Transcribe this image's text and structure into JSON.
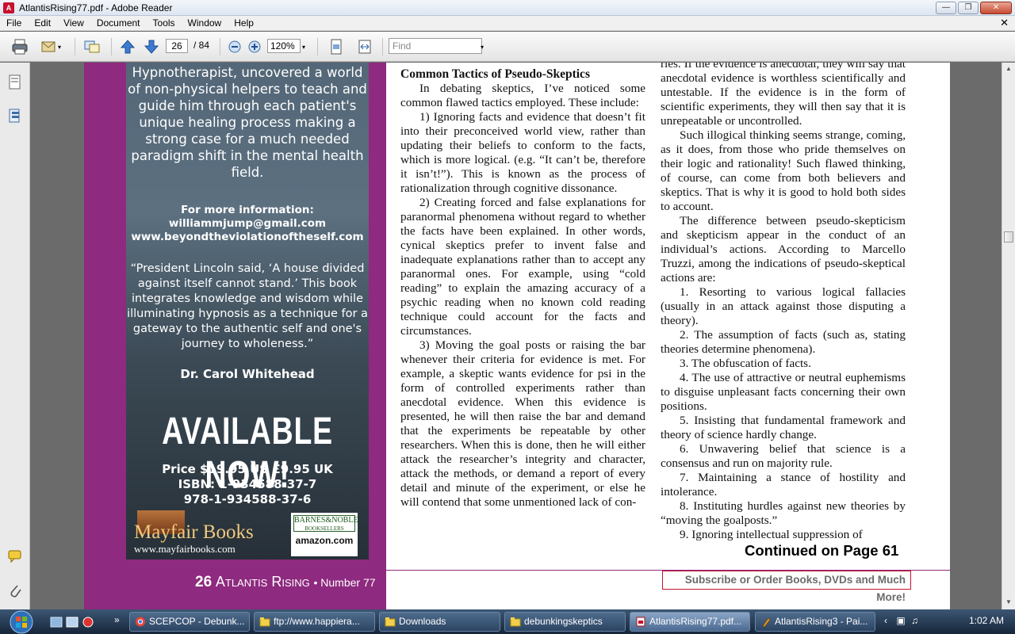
{
  "window": {
    "title": "AtlantisRising77.pdf - Adobe Reader"
  },
  "menu": [
    "File",
    "Edit",
    "View",
    "Document",
    "Tools",
    "Window",
    "Help"
  ],
  "toolbar": {
    "page_current": "26",
    "page_total": "/ 84",
    "zoom": "120%",
    "find_placeholder": "Find"
  },
  "ad": {
    "intro": "Hypnotherapist, uncovered a world of non-physical helpers to teach and guide him through each patient's unique healing process making a strong case for a much needed paradigm shift in the mental health field.",
    "info_heading": "For more information:",
    "email": "williammjump@gmail.com",
    "website": "www.beyondtheviolationoftheself.com",
    "quote": "“President Lincoln said, ‘A house divided against itself cannot stand.’ This book integrates knowledge and wisdom while illuminating hypnosis as a technique for a gateway to the authentic self and one's journey to wholeness.”",
    "quote_author": "Dr. Carol Whitehead",
    "available": "AVAILABLE NOW!",
    "price": "Price $19.95 US £9.95 UK",
    "isbn1": "ISBN: 1-934588-37-7",
    "isbn2": "978-1-934588-37-6",
    "publisher": "Mayfair Books",
    "publisher_url": "www.mayfairbooks.com",
    "bn_line1": "BARNES&NOBLE",
    "bn_line2": "BOOKSELLERS",
    "amazon": "amazon.com"
  },
  "footer": {
    "page_num": "26",
    "magazine": "Atlantis Rising",
    "issue": "• Number 77"
  },
  "article": {
    "heading": "Common Tactics of Pseudo-Skeptics",
    "col1": [
      "In debating skeptics, I’ve noticed some common flawed tactics employed. These include:",
      "1) Ignoring facts and evidence that doesn’t fit into their preconceived world view, rather than updating their beliefs to conform to the facts, which is more logical. (e.g. “It can’t be, therefore it isn’t!”). This is known as the process of rationalization through cognitive dissonance.",
      "2) Creating forced and false explanations for paranormal phenomena without regard to whether the facts have been explained. In other words, cynical skeptics prefer to invent false and inadequate explanations rather than to accept any paranormal ones. For example, using “cold reading” to explain the amazing accuracy of a psychic reading when no known cold reading technique could account for the facts and circumstances.",
      "3) Moving the goal posts or raising the bar whenever their criteria for evidence is met. For example, a skeptic wants evidence for psi in the form of controlled experiments rather than anecdotal evidence. When this evidence is presented, he will then raise the bar and demand that the experiments be repeatable by other researchers. When this is done, then he will either attack the researcher’s integrity and character, attack the methods, or demand a report of every detail and minute of the experiment, or else he will contend that some unmentioned lack of con-"
    ],
    "col2_first": "ries. If the evidence is anecdotal, they will say that anecdotal evidence is worthless scientifically and untestable. If the evidence is in the form of scientific experiments, they will then say that it is unrepeatable or uncontrolled.",
    "col2": [
      "Such illogical thinking seems strange, coming, as it does, from those who pride themselves on their logic and rationality! Such flawed thinking, of course, can come from both believers and skeptics. That is why it is good to hold both sides to account.",
      "The difference between pseudo-skepticism and skepticism appear in the conduct of an individual’s actions. According to Marcello Truzzi, among the indications of pseudo-skeptical actions are:",
      "1. Resorting to various logical fallacies (usually in an attack against those disputing a theory).",
      "2. The assumption of facts (such as, stating theories determine phenomena).",
      "3. The obfuscation of facts.",
      "4. The use of attractive or neutral euphemisms to disguise unpleasant facts concerning their own positions.",
      "5. Insisting that fundamental framework and theory of science hardly change.",
      "6. Unwavering belief that science is a consensus and run on majority rule.",
      "7. Maintaining a stance of hostility and intolerance.",
      "8. Instituting hurdles against new theories by “moving the goalposts.”",
      "9. Ignoring intellectual suppression of"
    ],
    "continued": "Continued on Page 61",
    "subscribe": "Subscribe or Order Books, DVDs and Much More!"
  },
  "taskbar": {
    "tasks": [
      "SCEPCOP - Debunk...",
      "ftp://www.happiera...",
      "Downloads",
      "debunkingskeptics",
      "AtlantisRising77.pdf...",
      "AtlantisRising3 - Pai..."
    ],
    "clock": "1:02 AM"
  }
}
